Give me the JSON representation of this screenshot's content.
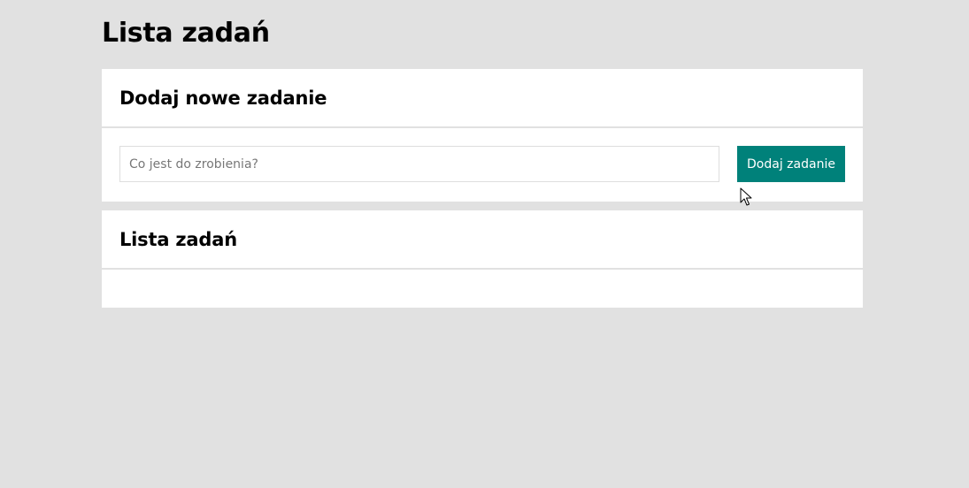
{
  "page": {
    "title": "Lista zadań"
  },
  "add_task_card": {
    "heading": "Dodaj nowe zadanie",
    "input_value": "",
    "input_placeholder": "Co jest do zrobienia?",
    "button_label": "Dodaj zadanie"
  },
  "task_list_card": {
    "heading": "Lista zadań",
    "items": []
  },
  "colors": {
    "background": "#e1e1e1",
    "card": "#ffffff",
    "accent": "#00817a"
  },
  "icons": {
    "cursor": "mouse-pointer-icon"
  }
}
